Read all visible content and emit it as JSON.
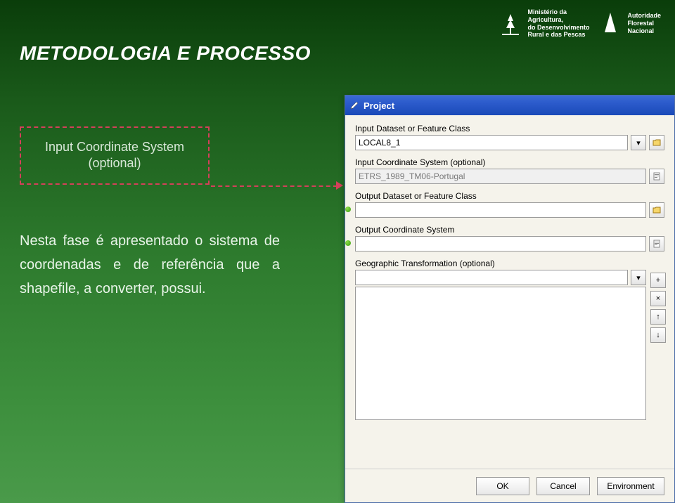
{
  "header": {
    "logo1_line1": "Ministério da",
    "logo1_line2": "Agricultura,",
    "logo1_line3": "do Desenvolvimento",
    "logo1_line4": "Rural e das Pescas",
    "logo2_line1": "Autoridade",
    "logo2_line2": "Florestal",
    "logo2_line3": "Nacional"
  },
  "title": "METODOLOGIA E PROCESSO",
  "annotation": {
    "line1": "Input Coordinate System",
    "line2": "(optional)"
  },
  "description": "Nesta fase é apresentado o sistema de coordenadas e de referência que a shapefile, a converter, possui.",
  "dialog": {
    "title": "Project",
    "fields": {
      "input_dataset_label": "Input Dataset or Feature Class",
      "input_dataset_value": "LOCAL8_1",
      "input_cs_label": "Input Coordinate System (optional)",
      "input_cs_value": "ETRS_1989_TM06-Portugal",
      "output_dataset_label": "Output Dataset or Feature Class",
      "output_dataset_value": "",
      "output_cs_label": "Output Coordinate System",
      "output_cs_value": "",
      "geo_xform_label": "Geographic Transformation (optional)"
    },
    "buttons": {
      "ok": "OK",
      "cancel": "Cancel",
      "env": "Environment"
    }
  }
}
